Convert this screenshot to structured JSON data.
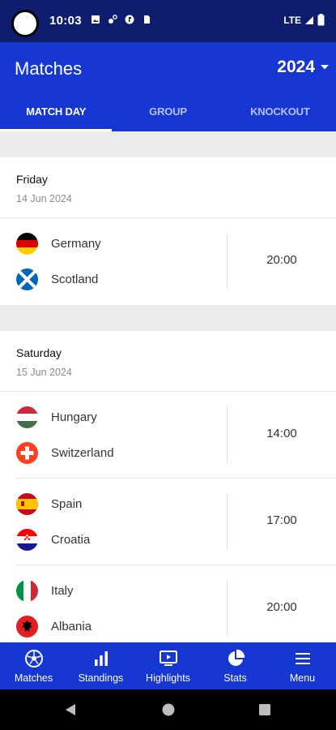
{
  "status_bar": {
    "time": "10:03",
    "network": "LTE"
  },
  "app_bar": {
    "title": "Matches",
    "year": "2024"
  },
  "tabs": [
    {
      "label": "MATCH DAY",
      "active": true
    },
    {
      "label": "GROUP",
      "active": false
    },
    {
      "label": "KNOCKOUT",
      "active": false
    }
  ],
  "days": [
    {
      "name": "Friday",
      "date": "14 Jun 2024",
      "matches": [
        {
          "home": "Germany",
          "away": "Scotland",
          "time": "20:00",
          "home_flag": "germany-flag-icon",
          "away_flag": "scotland-flag-icon"
        }
      ]
    },
    {
      "name": "Saturday",
      "date": "15 Jun 2024",
      "matches": [
        {
          "home": "Hungary",
          "away": "Switzerland",
          "time": "14:00",
          "home_flag": "hungary-flag-icon",
          "away_flag": "switzerland-flag-icon"
        },
        {
          "home": "Spain",
          "away": "Croatia",
          "time": "17:00",
          "home_flag": "spain-flag-icon",
          "away_flag": "croatia-flag-icon"
        },
        {
          "home": "Italy",
          "away": "Albania",
          "time": "20:00",
          "home_flag": "italy-flag-icon",
          "away_flag": "albania-flag-icon"
        }
      ]
    }
  ],
  "bottom_nav": [
    {
      "label": "Matches",
      "icon": "soccer-ball-icon"
    },
    {
      "label": "Standings",
      "icon": "bar-chart-icon"
    },
    {
      "label": "Highlights",
      "icon": "video-play-icon"
    },
    {
      "label": "Stats",
      "icon": "pie-chart-icon"
    },
    {
      "label": "Menu",
      "icon": "hamburger-menu-icon"
    }
  ],
  "colors": {
    "primary": "#1737d3",
    "status_bar": "#0f1d6e",
    "background": "#ebebeb"
  }
}
